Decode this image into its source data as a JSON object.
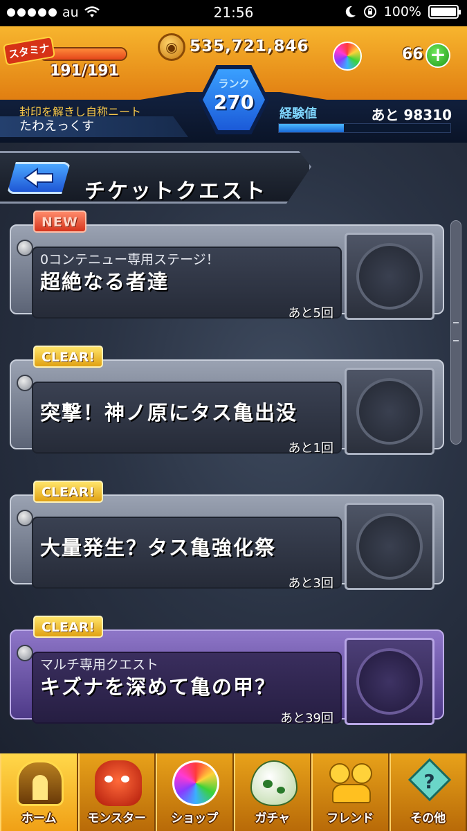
{
  "status_bar": {
    "carrier": "au",
    "time": "21:56",
    "battery": "100%"
  },
  "hud": {
    "stamina_tag": "スタミナ",
    "stamina": "191/191",
    "stamina_fraction": 1.0,
    "coins": "535,721,846",
    "gems": "66",
    "rank_label": "ランク",
    "rank": "270",
    "player_title": "封印を解きし自称ニート",
    "player_name": "たわえっくす",
    "exp_label": "経験値",
    "exp_remaining": "あと 98310",
    "exp_fraction": 0.38
  },
  "header": {
    "title": "チケットクエスト"
  },
  "quests": [
    {
      "badge": "NEW",
      "subtitle": "0コンテニュー専用ステージ！",
      "name": "超絶なる者達",
      "remaining": "あと5回",
      "variant": "gray"
    },
    {
      "badge": "CLEAR!",
      "subtitle": "",
      "name": "突撃！神ノ原にタス亀出没",
      "remaining": "あと1回",
      "variant": "gray"
    },
    {
      "badge": "CLEAR!",
      "subtitle": "",
      "name": "大量発生？タス亀強化祭",
      "remaining": "あと3回",
      "variant": "gray"
    },
    {
      "badge": "CLEAR!",
      "subtitle": "マルチ専用クエスト",
      "name": "キズナを深めて亀の甲？",
      "remaining": "あと39回",
      "variant": "purple"
    }
  ],
  "nav": [
    {
      "label": "ホーム",
      "icon": "home-icon"
    },
    {
      "label": "モンスター",
      "icon": "monster-icon"
    },
    {
      "label": "ショップ",
      "icon": "shop-orb-icon"
    },
    {
      "label": "ガチャ",
      "icon": "gacha-egg-icon"
    },
    {
      "label": "フレンド",
      "icon": "friend-icon"
    },
    {
      "label": "その他",
      "icon": "other-icon"
    }
  ],
  "colors": {
    "hud_orange": "#f7b52e",
    "rank_blue": "#1b5ad8",
    "badge_clear": "#e0a112",
    "badge_new": "#d6341c",
    "purple_card": "#6a56a8"
  }
}
